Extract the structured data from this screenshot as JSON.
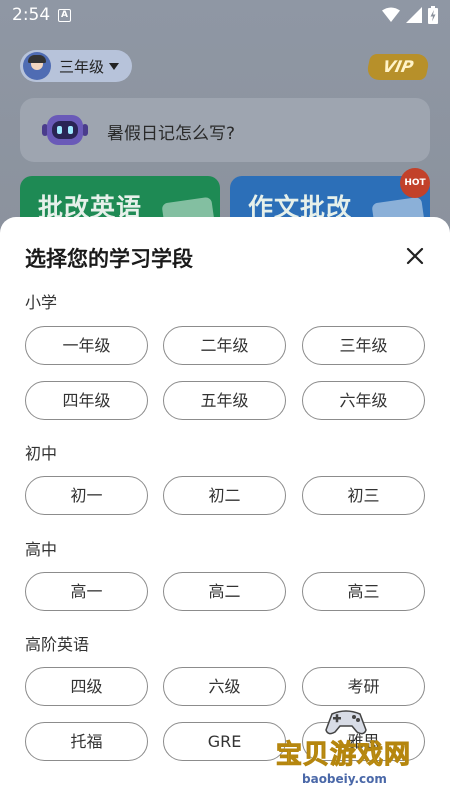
{
  "status_bar": {
    "time": "2:54",
    "notification_letter": "A"
  },
  "header": {
    "grade_selector_label": "三年级",
    "vip_label": "VIP"
  },
  "ask_box": {
    "placeholder": "暑假日记怎么写?"
  },
  "cards": [
    {
      "title": "批改英语"
    },
    {
      "title": "作文批改",
      "badge": "HOT"
    }
  ],
  "sheet": {
    "title": "选择您的学习学段",
    "sections": [
      {
        "label": "小学",
        "options": [
          "一年级",
          "二年级",
          "三年级",
          "四年级",
          "五年级",
          "六年级"
        ]
      },
      {
        "label": "初中",
        "options": [
          "初一",
          "初二",
          "初三"
        ]
      },
      {
        "label": "高中",
        "options": [
          "高一",
          "高二",
          "高三"
        ]
      },
      {
        "label": "高阶英语",
        "options": [
          "四级",
          "六级",
          "考研",
          "托福",
          "GRE",
          "雅思"
        ]
      }
    ]
  },
  "watermark": {
    "title": "宝贝游戏网",
    "url": "baobeiy.com"
  },
  "colors": {
    "card_green": "#1e8a54",
    "card_blue": "#2c6fb8",
    "hot_red": "#c2412a",
    "vip_gold": "#b7902a",
    "option_border": "#8c8c8c"
  }
}
